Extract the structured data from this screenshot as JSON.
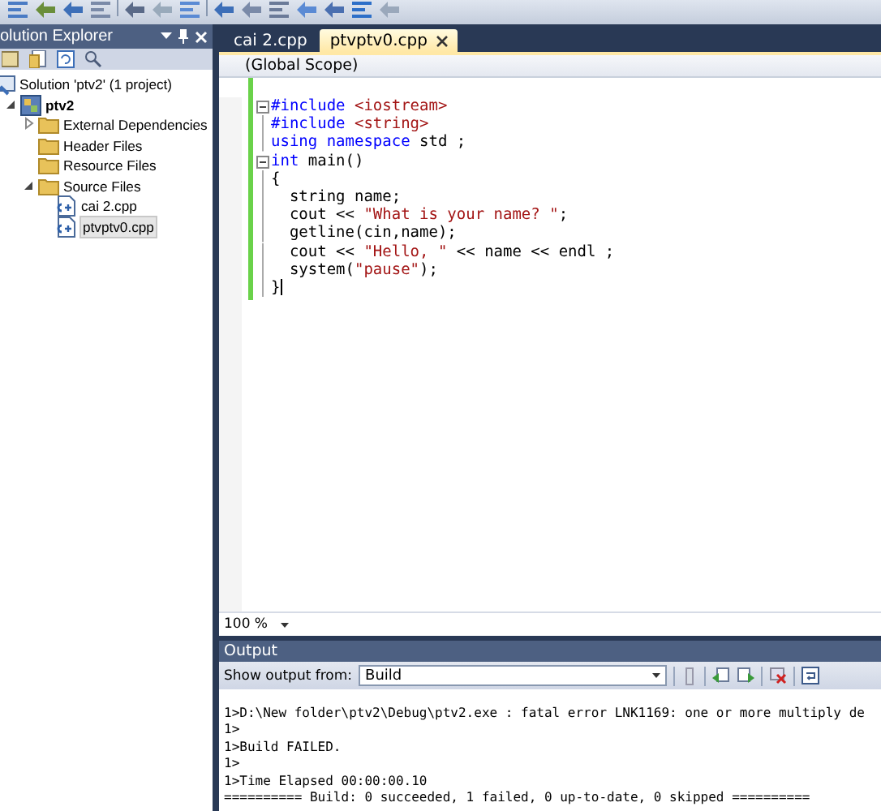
{
  "solution_explorer": {
    "title": "olution Explorer",
    "tree": [
      {
        "label": "Solution 'ptv2' (1 project)",
        "kind": "solution",
        "selected": false,
        "children": [
          {
            "label": "ptv2",
            "kind": "project",
            "selected": false,
            "expanded": true,
            "children": [
              {
                "label": "External Dependencies",
                "kind": "folder",
                "selected": false,
                "expanded": false
              },
              {
                "label": "Header Files",
                "kind": "folder",
                "selected": false
              },
              {
                "label": "Resource Files",
                "kind": "folder",
                "selected": false
              },
              {
                "label": "Source Files",
                "kind": "folder",
                "selected": false,
                "expanded": true,
                "children": [
                  {
                    "label": "cai 2.cpp",
                    "kind": "cpp",
                    "selected": false
                  },
                  {
                    "label": "ptvptv0.cpp",
                    "kind": "cpp",
                    "selected": true
                  }
                ]
              }
            ]
          }
        ]
      }
    ]
  },
  "editor": {
    "tabs": [
      {
        "label": "cai 2.cpp",
        "selected": false
      },
      {
        "label": "ptvptv0.cpp",
        "selected": true
      }
    ],
    "scope": "(Global Scope)",
    "lines": [
      {
        "collapsible": true,
        "segments": [
          {
            "text": "#include",
            "kind": "keyword"
          },
          {
            "text": " <iostream>",
            "kind": "string"
          }
        ]
      },
      {
        "collapsible": false,
        "segments": [
          {
            "text": "#include",
            "kind": "keyword"
          },
          {
            "text": " <string>",
            "kind": "string"
          }
        ]
      },
      {
        "collapsible": false,
        "segments": [
          {
            "text": "using",
            "kind": "keyword"
          },
          {
            "text": " namespace",
            "kind": "keyword"
          },
          {
            "text": " std ;"
          }
        ]
      },
      {
        "collapsible": true,
        "segments": [
          {
            "text": "int",
            "kind": "keyword"
          },
          {
            "text": " main()"
          }
        ]
      },
      {
        "collapsible": false,
        "segments": [
          {
            "text": "{"
          }
        ]
      },
      {
        "collapsible": false,
        "segments": [
          {
            "text": "  string name;"
          }
        ]
      },
      {
        "collapsible": false,
        "segments": [
          {
            "text": "  cout << "
          },
          {
            "text": "\"What is your name? \"",
            "kind": "string"
          },
          {
            "text": ";"
          }
        ]
      },
      {
        "collapsible": false,
        "segments": [
          {
            "text": "  getline(cin,name);"
          }
        ]
      },
      {
        "collapsible": false,
        "segments": [
          {
            "text": "  cout << "
          },
          {
            "text": "\"Hello, \"",
            "kind": "string"
          },
          {
            "text": " << name << endl ;"
          }
        ]
      },
      {
        "collapsible": false,
        "segments": [
          {
            "text": "  system("
          },
          {
            "text": "\"pause\"",
            "kind": "string"
          },
          {
            "text": ");"
          }
        ]
      },
      {
        "collapsible": false,
        "segments": [
          {
            "text": "}"
          }
        ]
      }
    ],
    "zoom": "100 %"
  },
  "output": {
    "title": "Output",
    "source_label": "Show output from:",
    "source": "Build",
    "lines": [
      "1>D:\\New folder\\ptv2\\Debug\\ptv2.exe : fatal error LNK1169: one or more multiply de",
      "1>",
      "1>Build FAILED.",
      "1>",
      "1>Time Elapsed 00:00:00.10",
      "========== Build: 0 succeeded, 1 failed, 0 up-to-date, 0 skipped =========="
    ]
  }
}
